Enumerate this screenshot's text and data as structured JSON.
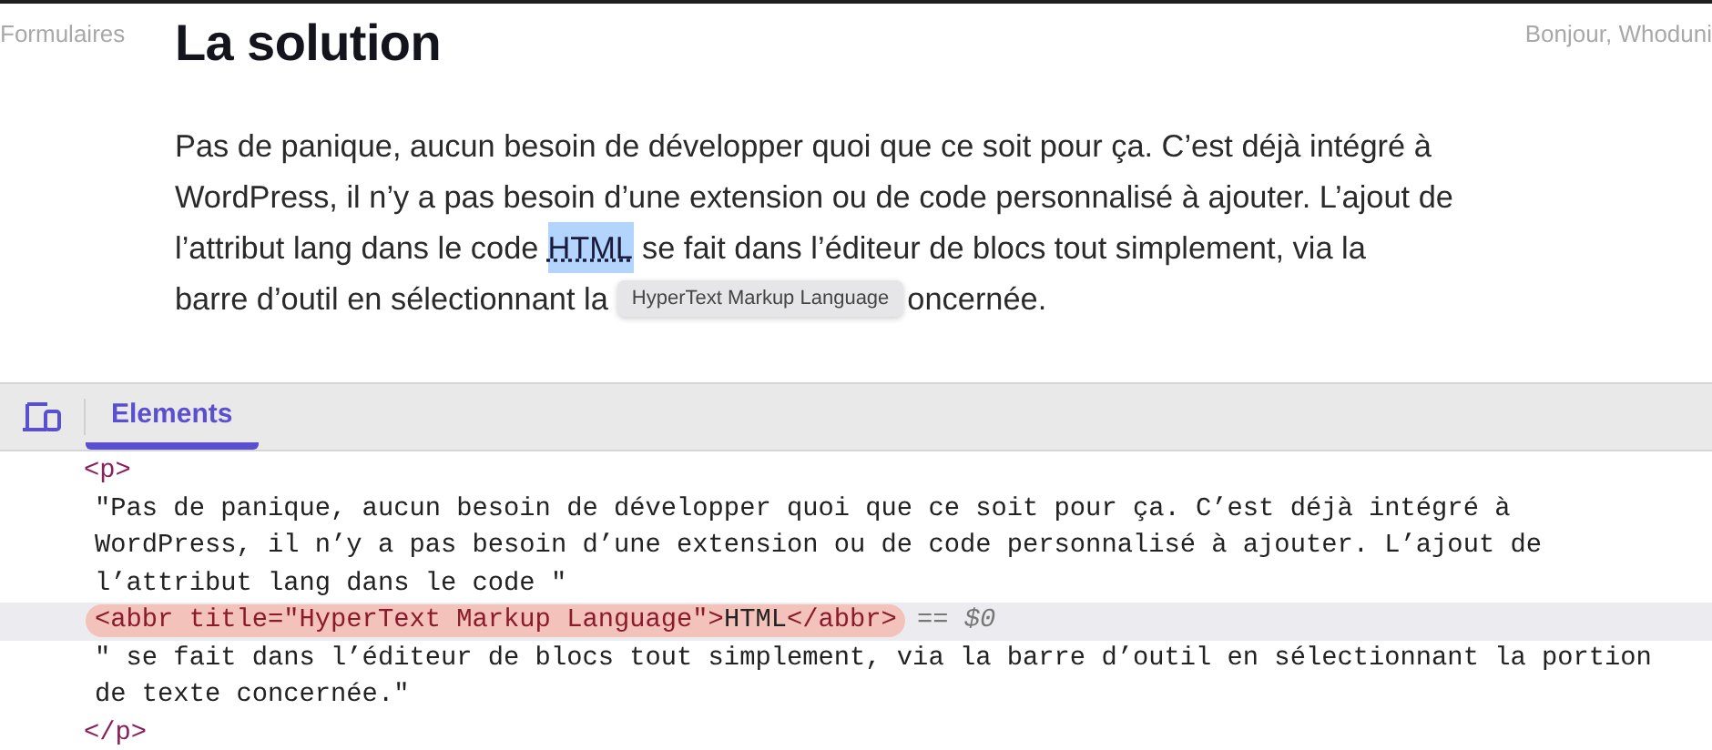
{
  "page": {
    "nav_left": "Formulaires",
    "nav_right": "Bonjour, Whoduni",
    "heading": "La solution",
    "paragraph": {
      "line_1": "Pas de panique, aucun besoin de développer quoi que ce soit pour ça. C’est déjà intégré à",
      "line_2": "WordPress, il n’y a pas besoin d’une extension ou de code personnalisé à ajouter. L’ajout de",
      "line_3_before": "l’attribut lang dans le code",
      "abbr": {
        "text": "HTML",
        "selected": true
      },
      "line_3_after": "se fait dans l’éditeur de blocs tout simplement, via la",
      "line_4_before": "barre d’outil en sélectionnant la",
      "tooltip": "HyperText Markup Language",
      "line_4_after": "oncernée."
    }
  },
  "devtools": {
    "tabs": [
      {
        "label": "Elements",
        "selected": true
      }
    ],
    "lines": [
      {
        "kind": "tag",
        "text": "<p>",
        "selected": false
      },
      {
        "kind": "text",
        "text": "\"Pas de panique, aucun besoin de développer quoi que ce soit pour ça. C’est déjà intégré à\nWordPress, il n’y a pas besoin d’une extension ou de code personnalisé à ajouter. L’ajout de\nl’attribut lang dans le code \"",
        "selected": false
      },
      {
        "kind": "element",
        "selected": true,
        "segments": [
          {
            "kind": "markup",
            "text": "<abbr title=\"HyperText Markup Language\">"
          },
          {
            "kind": "content",
            "text": "HTML"
          },
          {
            "kind": "markup",
            "text": "</abbr>"
          }
        ],
        "marker": "== ",
        "ref": "$0"
      },
      {
        "kind": "text",
        "text": "\" se fait dans l’éditeur de blocs tout simplement, via la barre d’outil en sélectionnant la portion\nde texte concernée.\"",
        "selected": false
      },
      {
        "kind": "tag",
        "text": "</p>",
        "selected": false
      }
    ]
  }
}
